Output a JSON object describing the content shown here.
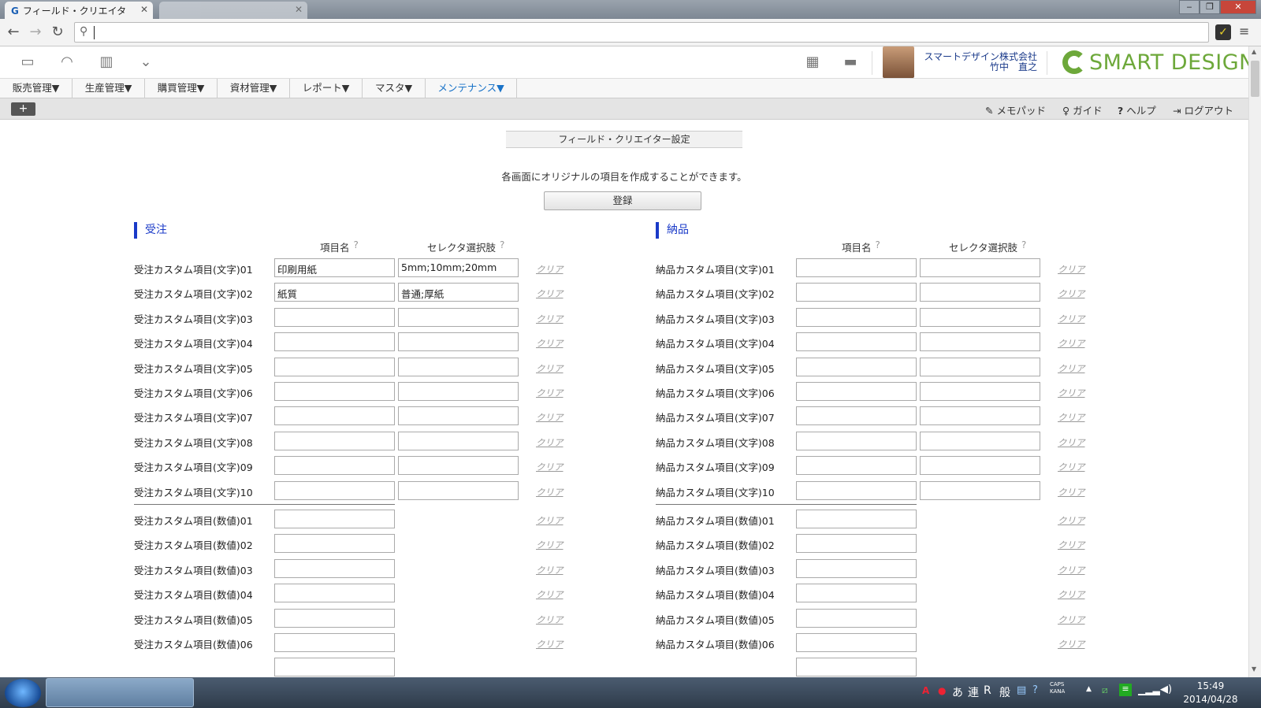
{
  "browser": {
    "tabs": [
      {
        "favicon": "G",
        "label": "フィールド・クリエイタ"
      },
      {
        "label": ""
      }
    ],
    "window_controls": [
      "‒",
      "❐",
      "✕"
    ]
  },
  "header": {
    "company": "スマートデザイン株式会社",
    "user": "竹中　直之",
    "logo": "SMART DESIGN"
  },
  "menu": {
    "items": [
      "販売管理▼",
      "生産管理▼",
      "購買管理▼",
      "資材管理▼",
      "レポート▼",
      "マスタ▼",
      "メンテナンス▼"
    ]
  },
  "subbar": {
    "plus": "+",
    "links": [
      "メモパッド",
      "ガイド",
      "ヘルプ",
      "ログアウト"
    ]
  },
  "page": {
    "title": "フィールド・クリエイター設定",
    "description": "各画面にオリジナルの項目を作成することができます。",
    "register_button": "登録",
    "col_name": "項目名",
    "col_selector": "セレクタ選択肢",
    "help_mark": "?",
    "clear_label": "クリア"
  },
  "left_section": {
    "title": "受注",
    "text_rows": [
      {
        "label": "受注カスタム項目(文字)01",
        "name": "印刷用紙",
        "selector": "5mm;10mm;20mm"
      },
      {
        "label": "受注カスタム項目(文字)02",
        "name": "紙質",
        "selector": "普通;厚紙"
      },
      {
        "label": "受注カスタム項目(文字)03",
        "name": "",
        "selector": ""
      },
      {
        "label": "受注カスタム項目(文字)04",
        "name": "",
        "selector": ""
      },
      {
        "label": "受注カスタム項目(文字)05",
        "name": "",
        "selector": ""
      },
      {
        "label": "受注カスタム項目(文字)06",
        "name": "",
        "selector": ""
      },
      {
        "label": "受注カスタム項目(文字)07",
        "name": "",
        "selector": ""
      },
      {
        "label": "受注カスタム項目(文字)08",
        "name": "",
        "selector": ""
      },
      {
        "label": "受注カスタム項目(文字)09",
        "name": "",
        "selector": ""
      },
      {
        "label": "受注カスタム項目(文字)10",
        "name": "",
        "selector": ""
      }
    ],
    "number_rows": [
      {
        "label": "受注カスタム項目(数値)01",
        "name": ""
      },
      {
        "label": "受注カスタム項目(数値)02",
        "name": ""
      },
      {
        "label": "受注カスタム項目(数値)03",
        "name": ""
      },
      {
        "label": "受注カスタム項目(数値)04",
        "name": ""
      },
      {
        "label": "受注カスタム項目(数値)05",
        "name": ""
      },
      {
        "label": "受注カスタム項目(数値)06",
        "name": ""
      }
    ]
  },
  "right_section": {
    "title": "納品",
    "text_rows": [
      {
        "label": "納品カスタム項目(文字)01",
        "name": "",
        "selector": ""
      },
      {
        "label": "納品カスタム項目(文字)02",
        "name": "",
        "selector": ""
      },
      {
        "label": "納品カスタム項目(文字)03",
        "name": "",
        "selector": ""
      },
      {
        "label": "納品カスタム項目(文字)04",
        "name": "",
        "selector": ""
      },
      {
        "label": "納品カスタム項目(文字)05",
        "name": "",
        "selector": ""
      },
      {
        "label": "納品カスタム項目(文字)06",
        "name": "",
        "selector": ""
      },
      {
        "label": "納品カスタム項目(文字)07",
        "name": "",
        "selector": ""
      },
      {
        "label": "納品カスタム項目(文字)08",
        "name": "",
        "selector": ""
      },
      {
        "label": "納品カスタム項目(文字)09",
        "name": "",
        "selector": ""
      },
      {
        "label": "納品カスタム項目(文字)10",
        "name": "",
        "selector": ""
      }
    ],
    "number_rows": [
      {
        "label": "納品カスタム項目(数値)01",
        "name": ""
      },
      {
        "label": "納品カスタム項目(数値)02",
        "name": ""
      },
      {
        "label": "納品カスタム項目(数値)03",
        "name": ""
      },
      {
        "label": "納品カスタム項目(数値)04",
        "name": ""
      },
      {
        "label": "納品カスタム項目(数値)05",
        "name": ""
      },
      {
        "label": "納品カスタム項目(数値)06",
        "name": ""
      }
    ]
  },
  "taskbar": {
    "tray_text": [
      "あ",
      "連",
      "R",
      "般"
    ],
    "caps": "CAPS",
    "kana": "KANA",
    "time": "15:49",
    "date": "2014/04/28"
  },
  "colors": {
    "accent": "#1a73c8",
    "section": "#1a3ac8",
    "brand": "#6da83a"
  }
}
